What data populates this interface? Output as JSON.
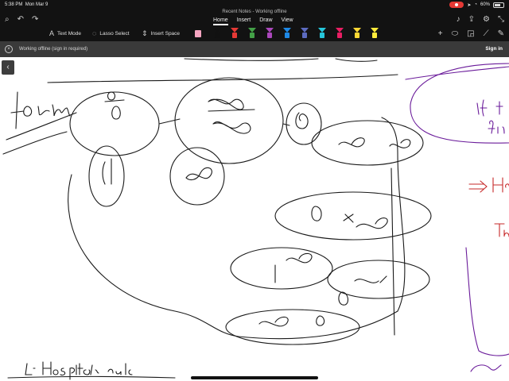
{
  "status": {
    "time": "5:38 PM",
    "date": "Mon Mar 9",
    "battery": "60%"
  },
  "doc": {
    "title": "Recent Notes - Working offline"
  },
  "tabs": [
    {
      "label": "Home"
    },
    {
      "label": "Insert"
    },
    {
      "label": "Draw"
    },
    {
      "label": "View"
    }
  ],
  "tools": {
    "text_mode": "Text Mode",
    "lasso_select": "Lasso Select",
    "insert_space": "Insert Space"
  },
  "pen_colors": [
    "#111111",
    "#e53935",
    "#43a047",
    "#ab47bc",
    "#1e88e5",
    "#5c6bc0",
    "#26c6da",
    "#e91e63",
    "#fdd835",
    "#ffeb3b"
  ],
  "banner": {
    "message": "Working offline (sign in required)",
    "signin_label": "Sign in"
  },
  "ink": {
    "color": "#1a1a1a",
    "margin_purple": "#6a1b9a",
    "margin_red": "#c62828"
  }
}
